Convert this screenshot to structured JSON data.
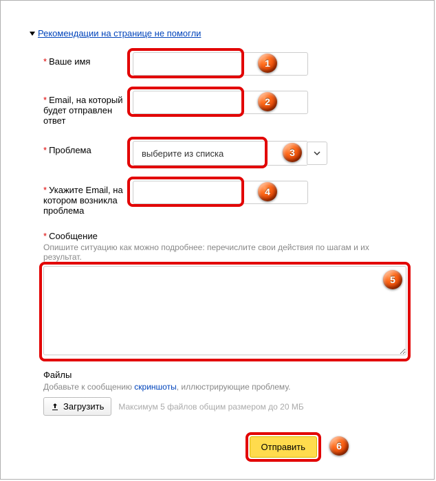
{
  "header": {
    "link_text": "Рекомендации на странице не помогли"
  },
  "form": {
    "name": {
      "label": "Ваше имя",
      "value": ""
    },
    "email": {
      "label": "Email, на который будет отправлен ответ",
      "value": ""
    },
    "problem": {
      "label": "Проблема",
      "placeholder": "выберите из списка"
    },
    "problem_email": {
      "label": "Укажите Email, на котором возникла проблема",
      "value": ""
    },
    "message": {
      "label": "Сообщение",
      "help": "Опишите ситуацию как можно подробнее: перечислите свои действия по шагам и их результат.",
      "value": ""
    },
    "files": {
      "title": "Файлы",
      "help_prefix": "Добавьте к сообщению ",
      "help_link": "скриншоты",
      "help_suffix": ", иллюстрирующие проблему.",
      "upload_label": "Загрузить",
      "limit_hint": "Максимум 5 файлов общим размером до 20 МБ"
    },
    "submit_label": "Отправить"
  },
  "annotations": {
    "b1": "1",
    "b2": "2",
    "b3": "3",
    "b4": "4",
    "b5": "5",
    "b6": "6"
  }
}
